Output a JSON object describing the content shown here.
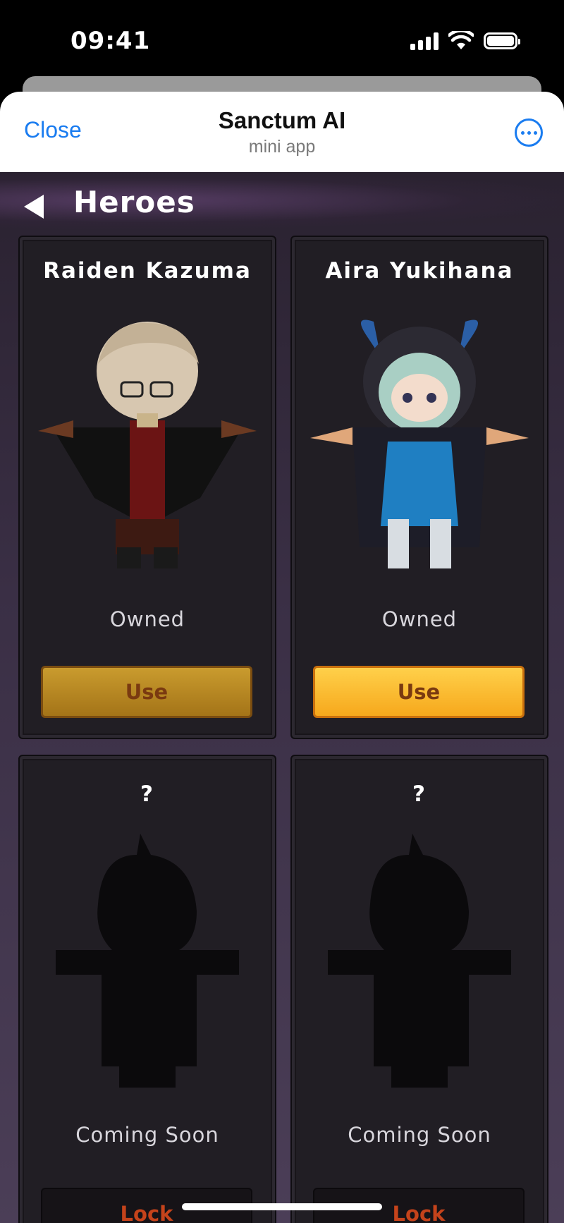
{
  "status_bar": {
    "time": "09:41"
  },
  "header": {
    "close_label": "Close",
    "app_title": "Sanctum AI",
    "app_subtitle": "mini app"
  },
  "page": {
    "title": "Heroes"
  },
  "heroes": [
    {
      "name": "Raiden Kazuma",
      "status": "Owned",
      "button": "Use",
      "button_style": "dim",
      "image": "hero-raiden-icon"
    },
    {
      "name": "Aira Yukihana",
      "status": "Owned",
      "button": "Use",
      "button_style": "bright",
      "image": "hero-aira-icon"
    },
    {
      "name": "?",
      "status": "Coming Soon",
      "button": "Lock",
      "button_style": "lock",
      "image": "hero-silhouette-icon"
    },
    {
      "name": "?",
      "status": "Coming Soon",
      "button": "Lock",
      "button_style": "lock",
      "image": "hero-silhouette-icon"
    }
  ],
  "colors": {
    "accent_blue": "#1a7cf0",
    "use_button": "#f6a81c",
    "lock_text": "#c5431b",
    "card_bg": "#211e24"
  }
}
